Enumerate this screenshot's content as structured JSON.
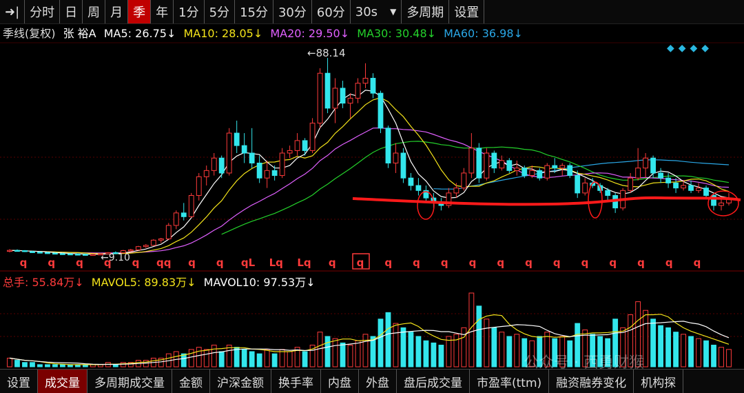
{
  "toolbar": {
    "nav_glyph": "➜|",
    "periods": [
      "分时",
      "日",
      "周",
      "月",
      "季",
      "年",
      "1分",
      "5分",
      "15分",
      "30分",
      "60分"
    ],
    "active_period": "季",
    "seconds_select": "30s",
    "multi_period": "多周期",
    "settings": "设置"
  },
  "legend": {
    "title": "季线(复权)",
    "stock_name": "张 裕A",
    "ma5": "MA5: 26.75↓",
    "ma10": "MA10: 28.05↓",
    "ma20": "MA20: 29.50↓",
    "ma30": "MA30: 30.48↓",
    "ma60": "MA60: 36.98↓"
  },
  "colors": {
    "up": "#ff3b3b",
    "down": "#33e6ec",
    "ma5": "#ffffff",
    "ma10": "#f3e31a",
    "ma20": "#e060ff",
    "ma30": "#24d12b",
    "ma60": "#2aa7e6",
    "support": "#ff1a1a"
  },
  "price_high_label": "88.14",
  "price_low_label": "9.10",
  "markers": [
    "q",
    "q",
    "q",
    "q",
    "q",
    "qq",
    "q",
    "q",
    "qL",
    "Lq",
    "Lq",
    "q",
    "q",
    "q",
    "q",
    "q",
    "q",
    "q",
    "q",
    "q",
    "q",
    "q",
    "q",
    "q",
    "q"
  ],
  "volume_legend": {
    "total": "总手: 55.84万↓",
    "mavol5": "MAVOL5: 89.83万↓",
    "mavol10": "MAVOL10: 97.53万↓"
  },
  "bottom_tabs": [
    "设置",
    "成交量",
    "多周期成交量",
    "金额",
    "沪深金额",
    "换手率",
    "内盘",
    "外盘",
    "盘后成交量",
    "市盈率(ttm)",
    "融资融券变化",
    "机构探"
  ],
  "active_tab": "成交量",
  "watermark": "公众号 · 西勇财猴",
  "chart_data": {
    "type": "candlestick",
    "title": "季线(复权) 张裕A",
    "price_max": 88.14,
    "price_min": 9.1,
    "candles": [
      [
        10.8,
        11.5,
        10.2,
        11.0
      ],
      [
        11.0,
        11.4,
        10.6,
        10.9
      ],
      [
        10.9,
        11.1,
        10.3,
        10.5
      ],
      [
        10.5,
        10.9,
        10.0,
        10.3
      ],
      [
        10.3,
        10.6,
        9.9,
        10.1
      ],
      [
        10.1,
        10.4,
        9.7,
        9.9
      ],
      [
        9.9,
        10.2,
        9.5,
        9.7
      ],
      [
        9.7,
        10.0,
        9.4,
        9.6
      ],
      [
        9.6,
        9.9,
        9.3,
        9.5
      ],
      [
        9.5,
        9.8,
        9.2,
        9.4
      ],
      [
        9.4,
        9.7,
        9.1,
        9.3
      ],
      [
        9.3,
        9.6,
        9.1,
        9.4
      ],
      [
        9.4,
        9.8,
        9.2,
        9.6
      ],
      [
        9.6,
        10.3,
        9.4,
        10.1
      ],
      [
        10.1,
        10.6,
        9.7,
        10.0
      ],
      [
        10.0,
        11.2,
        9.9,
        10.9
      ],
      [
        10.9,
        11.6,
        10.4,
        11.2
      ],
      [
        11.2,
        12.8,
        11.0,
        12.5
      ],
      [
        12.5,
        13.5,
        12.0,
        13.0
      ],
      [
        13.0,
        15.5,
        12.8,
        15.1
      ],
      [
        15.1,
        16.0,
        14.0,
        15.6
      ],
      [
        15.6,
        22.0,
        15.2,
        21.0
      ],
      [
        21.0,
        27.0,
        19.5,
        26.0
      ],
      [
        26.0,
        30.0,
        23.0,
        24.5
      ],
      [
        24.5,
        34.0,
        24.0,
        33.0
      ],
      [
        33.0,
        42.0,
        31.0,
        40.5
      ],
      [
        40.5,
        45.0,
        37.0,
        43.0
      ],
      [
        43.0,
        50.0,
        41.0,
        48.0
      ],
      [
        48.0,
        49.0,
        40.0,
        42.0
      ],
      [
        42.0,
        60.0,
        41.0,
        58.0
      ],
      [
        58.0,
        63.0,
        50.0,
        53.0
      ],
      [
        53.0,
        58.0,
        46.0,
        50.0
      ],
      [
        50.0,
        60.0,
        44.0,
        46.0
      ],
      [
        46.0,
        49.0,
        38.0,
        40.0
      ],
      [
        40.0,
        47.0,
        36.0,
        43.0
      ],
      [
        43.0,
        45.0,
        39.0,
        41.0
      ],
      [
        41.0,
        52.0,
        40.0,
        50.0
      ],
      [
        50.0,
        53.0,
        48.0,
        51.0
      ],
      [
        51.0,
        58.0,
        49.0,
        55.0
      ],
      [
        55.0,
        56.0,
        49.0,
        51.0
      ],
      [
        51.0,
        64.0,
        50.0,
        62.0
      ],
      [
        62.0,
        84.0,
        60.0,
        82.0
      ],
      [
        82.0,
        88.14,
        66.0,
        68.0
      ],
      [
        68.0,
        80.0,
        62.0,
        76.0
      ],
      [
        76.0,
        79.0,
        68.0,
        70.0
      ],
      [
        70.0,
        74.0,
        64.0,
        72.0
      ],
      [
        72.0,
        80.0,
        70.0,
        78.0
      ],
      [
        78.0,
        86.0,
        76.0,
        80.0
      ],
      [
        80.0,
        82.0,
        72.0,
        74.0
      ],
      [
        74.0,
        75.0,
        58.0,
        60.0
      ],
      [
        60.0,
        61.0,
        44.0,
        46.0
      ],
      [
        46.0,
        54.0,
        42.0,
        50.0
      ],
      [
        50.0,
        52.0,
        38.0,
        40.0
      ],
      [
        40.0,
        42.0,
        35.0,
        37.0
      ],
      [
        37.0,
        40.0,
        33.0,
        35.0
      ],
      [
        35.0,
        37.0,
        30.0,
        32.0
      ],
      [
        32.0,
        34.0,
        28.0,
        30.0
      ],
      [
        30.0,
        32.0,
        27.0,
        29.0
      ],
      [
        29.0,
        36.0,
        28.0,
        34.0
      ],
      [
        34.0,
        38.0,
        32.0,
        36.0
      ],
      [
        36.0,
        44.0,
        35.0,
        42.0
      ],
      [
        42.0,
        58.0,
        40.0,
        52.0
      ],
      [
        52.0,
        54.0,
        38.0,
        40.0
      ],
      [
        40.0,
        52.0,
        39.0,
        50.0
      ],
      [
        50.0,
        51.0,
        42.0,
        44.0
      ],
      [
        44.0,
        49.0,
        43.0,
        47.0
      ],
      [
        47.0,
        48.0,
        42.0,
        43.0
      ],
      [
        43.0,
        47.0,
        41.0,
        44.0
      ],
      [
        44.0,
        45.0,
        40.0,
        41.0
      ],
      [
        41.0,
        45.0,
        40.0,
        43.0
      ],
      [
        43.0,
        44.0,
        39.0,
        40.0
      ],
      [
        40.0,
        46.0,
        39.0,
        45.0
      ],
      [
        45.0,
        48.0,
        42.0,
        44.0
      ],
      [
        44.0,
        46.0,
        41.0,
        45.0
      ],
      [
        45.0,
        46.0,
        40.0,
        41.0
      ],
      [
        41.0,
        43.0,
        32.0,
        34.0
      ],
      [
        34.0,
        40.0,
        33.0,
        38.0
      ],
      [
        38.0,
        40.0,
        36.0,
        37.0
      ],
      [
        37.0,
        38.0,
        34.0,
        35.0
      ],
      [
        35.0,
        36.0,
        31.0,
        33.0
      ],
      [
        33.0,
        34.0,
        26.0,
        28.0
      ],
      [
        28.0,
        36.0,
        27.0,
        35.0
      ],
      [
        35.0,
        42.0,
        34.0,
        40.0
      ],
      [
        40.0,
        52.0,
        39.0,
        44.0
      ],
      [
        44.0,
        50.0,
        40.0,
        48.0
      ],
      [
        48.0,
        49.0,
        40.0,
        42.0
      ],
      [
        42.0,
        44.0,
        38.0,
        40.0
      ],
      [
        40.0,
        42.0,
        36.0,
        38.0
      ],
      [
        38.0,
        40.0,
        34.0,
        36.0
      ],
      [
        36.0,
        39.0,
        35.0,
        37.0
      ],
      [
        37.0,
        39.0,
        34.0,
        35.0
      ],
      [
        35.0,
        38.0,
        34.0,
        36.0
      ],
      [
        36.0,
        37.0,
        32.0,
        33.0
      ],
      [
        33.0,
        34.0,
        27.0,
        29.0
      ],
      [
        29.0,
        32.0,
        27.0,
        30.0
      ],
      [
        30.0,
        34.0,
        29.0,
        32.0
      ]
    ],
    "volumes": [
      4,
      3,
      2,
      2,
      1,
      1,
      1,
      1,
      1,
      1,
      1,
      1,
      1,
      2,
      1,
      2,
      2,
      3,
      3,
      4,
      4,
      6,
      7,
      6,
      8,
      9,
      8,
      10,
      7,
      10,
      9,
      8,
      7,
      6,
      8,
      6,
      8,
      7,
      9,
      7,
      10,
      16,
      14,
      13,
      11,
      10,
      12,
      15,
      14,
      22,
      25,
      20,
      18,
      16,
      14,
      12,
      11,
      10,
      14,
      15,
      18,
      34,
      28,
      22,
      18,
      16,
      14,
      15,
      13,
      12,
      14,
      16,
      13,
      14,
      12,
      20,
      17,
      15,
      14,
      13,
      22,
      18,
      24,
      30,
      26,
      22,
      19,
      18,
      16,
      15,
      14,
      13,
      12,
      10,
      9,
      8
    ]
  }
}
